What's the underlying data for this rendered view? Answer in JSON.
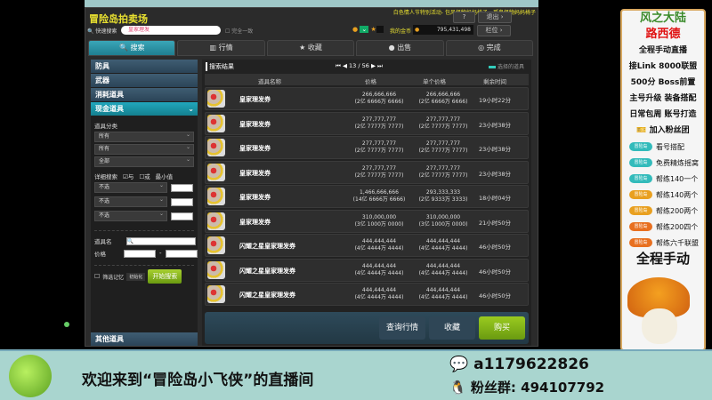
{
  "window": {
    "title": "冒险岛拍卖场",
    "marquee": "白色情人节特别活动- 包风怪物妈妈椅子，孤鬼怪物妈妈椅子",
    "help": "?",
    "exit": "退出 ›",
    "meso_label": "我的金币",
    "meso": "795,431,498",
    "slot": "栏位 ›"
  },
  "search": {
    "label": "快速搜索",
    "value": "皇家理发",
    "exact": "完全一致"
  },
  "tabs": [
    "搜索",
    "行情",
    "收藏",
    "出售",
    "完成"
  ],
  "sidebar": {
    "categories": [
      "防具",
      "武器",
      "消耗道具",
      "现金道具"
    ],
    "other": "其他道具",
    "filter_label": "道具分类",
    "selects": [
      "所有",
      "所有",
      "全部"
    ],
    "detail_label": "详细搜索",
    "and": "与",
    "or": "或",
    "min_label": "最小值",
    "detail_selects": [
      "不选",
      "不选",
      "不选"
    ],
    "name_label": "道具名",
    "price_label": "价格",
    "memory": "筛选记忆",
    "init": "初始化",
    "start": "开始搜索"
  },
  "results": {
    "title": "搜索结果",
    "page": "13 / 56",
    "legend": "选择的道具",
    "headers": [
      "道具名称",
      "价格",
      "单个价格",
      "剩余时间"
    ],
    "rows": [
      {
        "name": "皇家理发券",
        "price": "266,666,666",
        "price_cn": "(2亿 6666万 6666)",
        "unit": "266,666,666",
        "unit_cn": "(2亿 6666万 6666)",
        "time": "19小时22分"
      },
      {
        "name": "皇家理发券",
        "price": "277,777,777",
        "price_cn": "(2亿 7777万 7777)",
        "unit": "277,777,777",
        "unit_cn": "(2亿 7777万 7777)",
        "time": "23小时38分"
      },
      {
        "name": "皇家理发券",
        "price": "277,777,777",
        "price_cn": "(2亿 7777万 7777)",
        "unit": "277,777,777",
        "unit_cn": "(2亿 7777万 7777)",
        "time": "23小时38分"
      },
      {
        "name": "皇家理发券",
        "price": "277,777,777",
        "price_cn": "(2亿 7777万 7777)",
        "unit": "277,777,777",
        "unit_cn": "(2亿 7777万 7777)",
        "time": "23小时38分"
      },
      {
        "name": "皇家理发券",
        "price": "1,466,666,666",
        "price_cn": "(14亿 6666万 6666)",
        "unit": "293,333,333",
        "unit_cn": "(2亿 9333万 3333)",
        "time": "18小时04分"
      },
      {
        "name": "皇家理发券",
        "price": "310,000,000",
        "price_cn": "(3亿 1000万 0000)",
        "unit": "310,000,000",
        "unit_cn": "(3亿 1000万 0000)",
        "time": "21小时50分"
      },
      {
        "name": "闪耀之星皇家理发券",
        "price": "444,444,444",
        "price_cn": "(4亿 4444万 4444)",
        "unit": "444,444,444",
        "unit_cn": "(4亿 4444万 4444)",
        "time": "46小时50分"
      },
      {
        "name": "闪耀之星皇家理发券",
        "price": "444,444,444",
        "price_cn": "(4亿 4444万 4444)",
        "unit": "444,444,444",
        "unit_cn": "(4亿 4444万 4444)",
        "time": "46小时50分"
      },
      {
        "name": "闪耀之星皇家理发券",
        "price": "444,444,444",
        "price_cn": "(4亿 4444万 4444)",
        "unit": "444,444,444",
        "unit_cn": "(4亿 4444万 4444)",
        "time": "46小时50分"
      }
    ],
    "buttons": {
      "market": "查询行情",
      "fav": "收藏",
      "buy": "购买"
    }
  },
  "stream": {
    "title1": "风之大陆",
    "title2": "路西德",
    "lines": [
      "全程手动直播",
      "接Link  8000联盟",
      "500分  Boss前置",
      "主号升级 装备搭配",
      "日常包周 账号打造"
    ],
    "join": "加入粉丝团",
    "perks": [
      {
        "tag": "冒险岛",
        "text": "看号搭配"
      },
      {
        "tag": "冒险岛",
        "text": "免费精炼摇窝"
      },
      {
        "tag": "冒险岛",
        "text": "帮练140一个"
      },
      {
        "tag": "冒险岛",
        "text": "帮练140两个"
      },
      {
        "tag": "冒险岛",
        "text": "帮练200两个"
      },
      {
        "tag": "冒险岛",
        "text": "帮练200四个"
      },
      {
        "tag": "冒险岛",
        "text": "帮练六千联盟"
      }
    ],
    "footer": "全程手动",
    "banner": "欢迎来到“冒险岛小飞侠”的直播间",
    "wechat": "a1179622826",
    "qq": "粉丝群: 494107792"
  }
}
